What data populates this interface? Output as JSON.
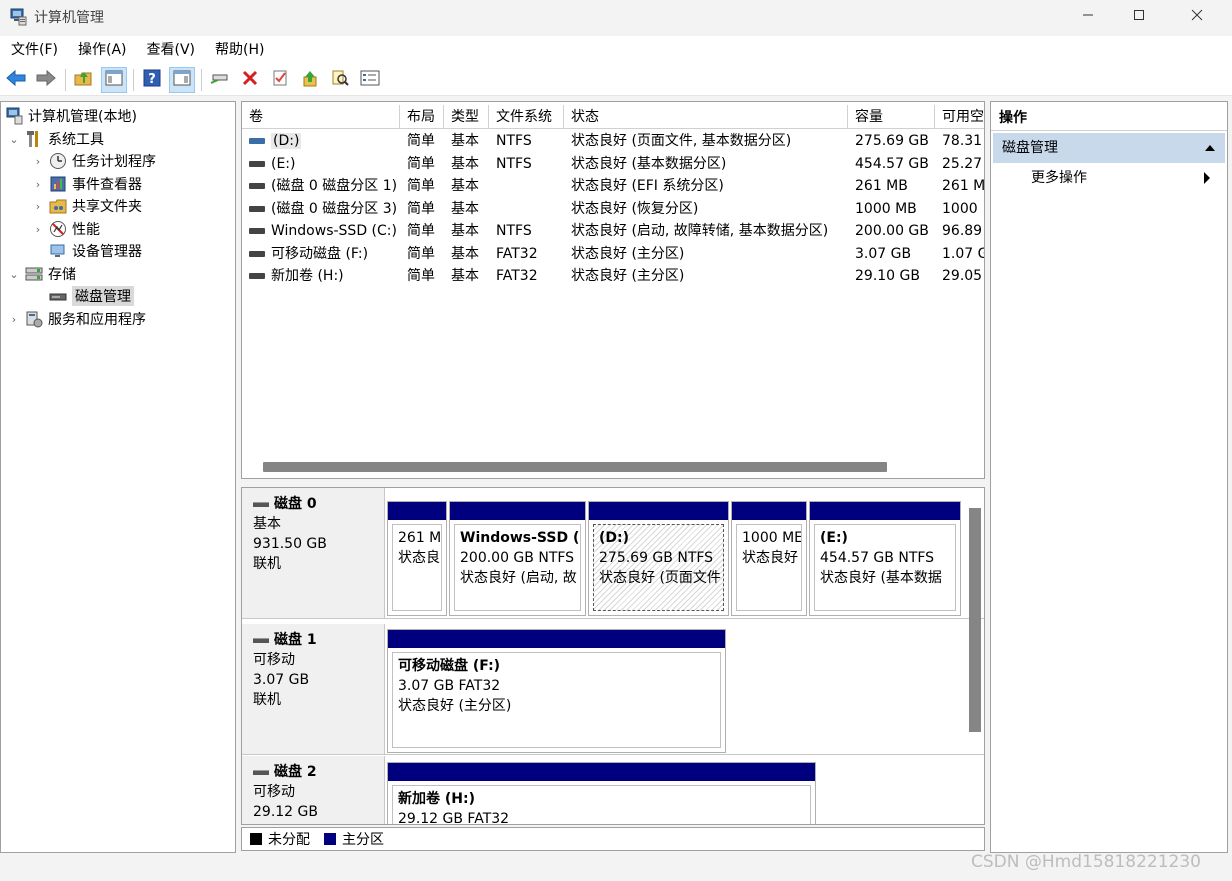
{
  "window": {
    "title": "计算机管理",
    "app_icon": "computer-management-icon",
    "controls": [
      "minimize-icon",
      "maximize-icon",
      "close-icon"
    ]
  },
  "menu": [
    "文件(F)",
    "操作(A)",
    "查看(V)",
    "帮助(H)"
  ],
  "toolbar_icons": [
    "back-arrow-icon",
    "forward-arrow-icon",
    "up-folder-icon",
    "show-hide-tree-icon",
    "help-icon",
    "show-hide-action-icon",
    "connect-icon",
    "delete-icon",
    "check-icon",
    "export-up-icon",
    "search-icon",
    "properties-icon"
  ],
  "tree": {
    "root": "计算机管理(本地)",
    "system_tools": "系统工具",
    "task_scheduler": "任务计划程序",
    "event_viewer": "事件查看器",
    "shared_folders": "共享文件夹",
    "performance": "性能",
    "device_manager": "设备管理器",
    "storage": "存储",
    "disk_management": "磁盘管理",
    "services_apps": "服务和应用程序"
  },
  "volume_columns": [
    "卷",
    "布局",
    "类型",
    "文件系统",
    "状态",
    "容量",
    "可用空"
  ],
  "volumes": [
    {
      "name": "(D:)",
      "layout": "简单",
      "type": "基本",
      "fs": "NTFS",
      "status": "状态良好 (页面文件, 基本数据分区)",
      "capacity": "275.69 GB",
      "free": "78.31"
    },
    {
      "name": "(E:)",
      "layout": "简单",
      "type": "基本",
      "fs": "NTFS",
      "status": "状态良好 (基本数据分区)",
      "capacity": "454.57 GB",
      "free": "25.27"
    },
    {
      "name": "(磁盘 0 磁盘分区 1)",
      "layout": "简单",
      "type": "基本",
      "fs": "",
      "status": "状态良好 (EFI 系统分区)",
      "capacity": "261 MB",
      "free": "261 M"
    },
    {
      "name": "(磁盘 0 磁盘分区 3)",
      "layout": "简单",
      "type": "基本",
      "fs": "",
      "status": "状态良好 (恢复分区)",
      "capacity": "1000 MB",
      "free": "1000"
    },
    {
      "name": "Windows-SSD (C:)",
      "layout": "简单",
      "type": "基本",
      "fs": "NTFS",
      "status": "状态良好 (启动, 故障转储, 基本数据分区)",
      "capacity": "200.00 GB",
      "free": "96.89"
    },
    {
      "name": "可移动磁盘 (F:)",
      "layout": "简单",
      "type": "基本",
      "fs": "FAT32",
      "status": "状态良好 (主分区)",
      "capacity": "3.07 GB",
      "free": "1.07 G"
    },
    {
      "name": "新加卷 (H:)",
      "layout": "简单",
      "type": "基本",
      "fs": "FAT32",
      "status": "状态良好 (主分区)",
      "capacity": "29.10 GB",
      "free": "29.05"
    }
  ],
  "disks": [
    {
      "name": "磁盘 0",
      "kind": "基本",
      "size": "931.50 GB",
      "state": "联机",
      "partitions": [
        {
          "name": "",
          "line1": "261 M",
          "line2": "状态良"
        },
        {
          "name": "Windows-SSD  (",
          "line1": "200.00 GB NTFS",
          "line2": "状态良好 (启动, 故"
        },
        {
          "name": "(D:)",
          "line1": "275.69 GB NTFS",
          "line2": "状态良好 (页面文件"
        },
        {
          "name": "",
          "line1": "1000 ME",
          "line2": "状态良好"
        },
        {
          "name": "(E:)",
          "line1": "454.57 GB NTFS",
          "line2": "状态良好 (基本数据"
        }
      ]
    },
    {
      "name": "磁盘 1",
      "kind": "可移动",
      "size": "3.07 GB",
      "state": "联机",
      "partitions": [
        {
          "name": "可移动磁盘  (F:)",
          "line1": "3.07 GB FAT32",
          "line2": "状态良好 (主分区)"
        }
      ]
    },
    {
      "name": "磁盘 2",
      "kind": "可移动",
      "size": "29.12 GB",
      "state": "",
      "partitions": [
        {
          "name": "新加卷  (H:)",
          "line1": "29.12 GB FAT32",
          "line2": ""
        }
      ]
    }
  ],
  "legend": {
    "unallocated": "未分配",
    "primary": "主分区",
    "unallocated_color": "#000000",
    "primary_color": "#00007f"
  },
  "actions": {
    "header": "操作",
    "section": "磁盘管理",
    "more": "更多操作"
  },
  "watermark": "CSDN @Hmd15818221230"
}
